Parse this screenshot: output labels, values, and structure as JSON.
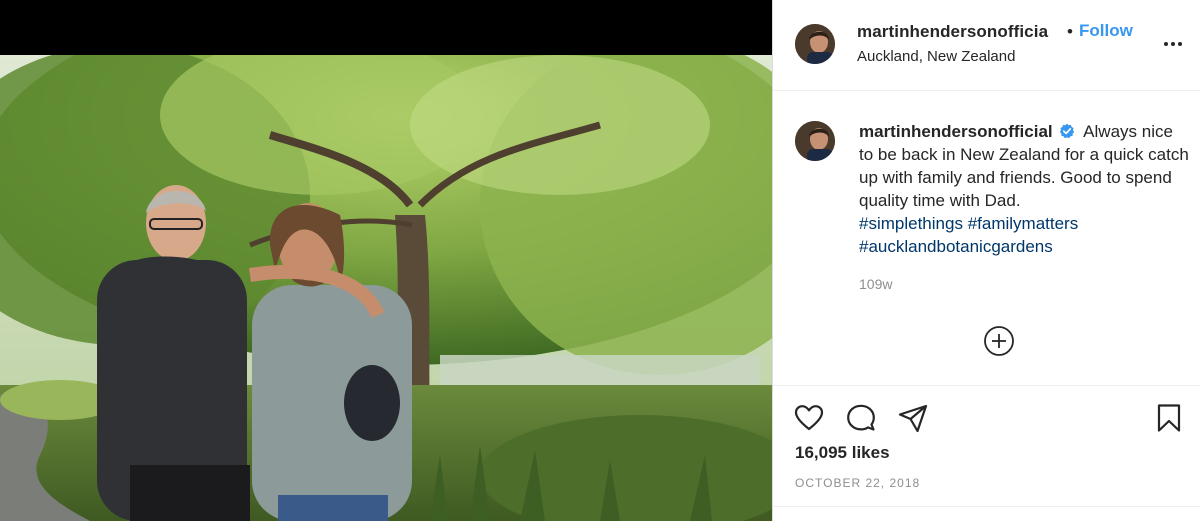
{
  "post": {
    "username": "martinhendersonofficial",
    "header_username": "martinhendersonofficia",
    "separator": "•",
    "follow_label": "Follow",
    "location": "Auckland, New Zealand",
    "caption_text": "Always nice to be back in New Zealand for a quick catch up with family and friends. Good to spend quality time with Dad.",
    "hashtags": [
      "#simplethings",
      "#familymatters",
      "#aucklandbotanicgardens"
    ],
    "age": "109w",
    "likes": "16,095 likes",
    "date": "OCTOBER 22, 2018"
  },
  "icons": {
    "more": "more-options-icon",
    "verified": "verified-badge-icon",
    "add": "load-comments-plus-icon",
    "like": "heart-icon",
    "comment": "comment-bubble-icon",
    "share": "paper-plane-icon",
    "save": "bookmark-icon"
  },
  "colors": {
    "link": "#3897f0",
    "hashtag": "#00376b",
    "verified": "#3897f0",
    "muted": "#8e8e8e"
  }
}
